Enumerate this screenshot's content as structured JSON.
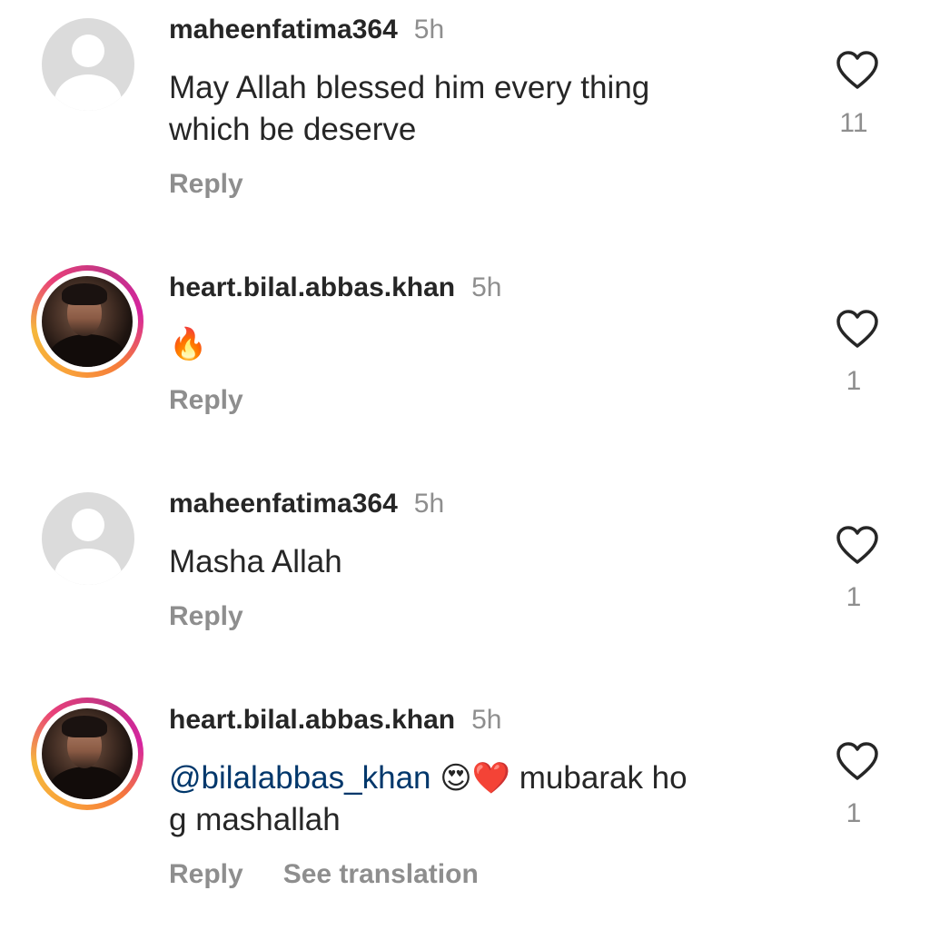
{
  "comments": [
    {
      "username": "maheenfatima364",
      "time": "5h",
      "text_line1": "May Allah blessed him every thing",
      "text_line2": "which be deserve",
      "reply_label": "Reply",
      "likes": "11",
      "avatar_icon": "default-avatar-icon"
    },
    {
      "username": "heart.bilal.abbas.khan",
      "time": "5h",
      "emoji": "🔥",
      "reply_label": "Reply",
      "likes": "1",
      "avatar_icon": "story-avatar-photo"
    },
    {
      "username": "maheenfatima364",
      "time": "5h",
      "text_line1": "Masha Allah",
      "reply_label": "Reply",
      "likes": "1",
      "avatar_icon": "default-avatar-icon"
    },
    {
      "username": "heart.bilal.abbas.khan",
      "time": "5h",
      "mention": "@bilalabbas_khan",
      "emoji": "😍❤️",
      "text_after": "mubarak ho",
      "text_line2": "g  mashallah",
      "reply_label": "Reply",
      "translate_label": "See translation",
      "likes": "1",
      "avatar_icon": "story-avatar-photo"
    }
  ],
  "colors": {
    "text": "#262626",
    "secondary": "#8e8e8e",
    "mention": "#00376b",
    "avatar_placeholder": "#dbdbdb"
  }
}
